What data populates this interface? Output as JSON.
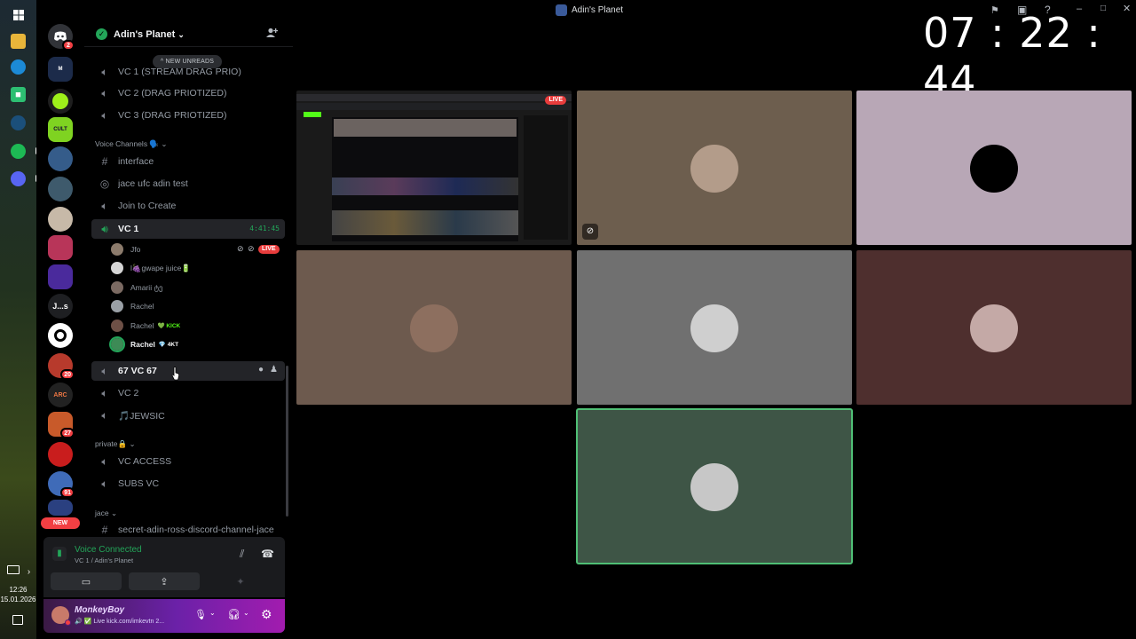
{
  "window": {
    "title": "Adin's Planet",
    "clock": "07 : 22 : 44"
  },
  "taskbar": {
    "time": "12:26",
    "date": "15.01.2026"
  },
  "guilds": {
    "badges": {
      "discord": "2",
      "g20": "20",
      "g27": "27",
      "g91": "91"
    },
    "text_guild": "J...s",
    "new_label": "NEW"
  },
  "server": {
    "name": "Adin's Planet"
  },
  "sidebar": {
    "new_unreads": "NEW UNREADS",
    "channels_top": [
      {
        "name": "VC 1 (STREAM DRAG PRIO)"
      },
      {
        "name": "VC 2 (DRAG PRIOTIZED)"
      },
      {
        "name": "VC 3 (DRAG PRIOTIZED)"
      }
    ],
    "cat_voice": "Voice Channels 🗣️",
    "voice_channels": [
      {
        "name": "interface",
        "icon": "hash"
      },
      {
        "name": "jace ufc adin test",
        "icon": "stage"
      },
      {
        "name": "Join to Create",
        "icon": "speaker"
      }
    ],
    "active_channel": {
      "name": "VC 1",
      "timer": "4:41:45"
    },
    "voice_users": [
      {
        "name": "Jfo",
        "live": "LIVE"
      },
      {
        "name": "l🍇gwape juice🔋"
      },
      {
        "name": "Amarii ტე"
      },
      {
        "name": "Rachel"
      },
      {
        "name": "Rachel",
        "tag": "💚 KICK"
      },
      {
        "name": "Rachel",
        "tag": "💎 4KT"
      }
    ],
    "channels_after": [
      {
        "name": "67 VC 67"
      },
      {
        "name": "VC 2"
      },
      {
        "name": "🎵JEWSIC"
      }
    ],
    "cat_private": "private🔒",
    "private_channels": [
      {
        "name": "VC ACCESS"
      },
      {
        "name": "SUBS VC"
      }
    ],
    "cat_jace": "jace",
    "jace_channels": [
      {
        "name": "secret-adin-ross-discord-channel-jace"
      }
    ]
  },
  "voice_panel": {
    "status": "Voice Connected",
    "where": "VC 1 / Adin's Planet"
  },
  "user_panel": {
    "name": "MonkeyBoy",
    "status": "🔊 ✅ Live kick.com/imkevtn 2..."
  },
  "stream_tile": {
    "live": "LIVE"
  },
  "colors": {
    "accent": "#23a559",
    "live": "#e83c3c",
    "speaking": "#4fbf75"
  }
}
